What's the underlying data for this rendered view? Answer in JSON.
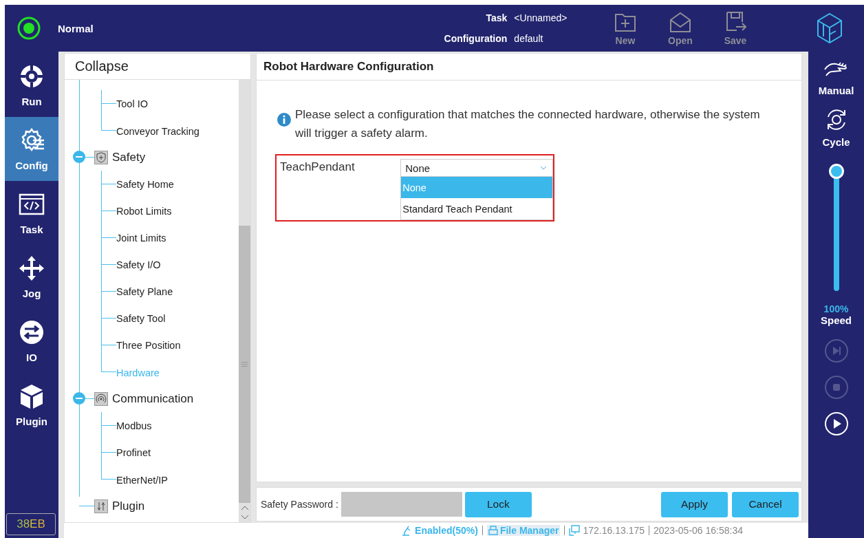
{
  "top_bar": {
    "status": "Normal",
    "task_label": "Task",
    "task_value": "<Unnamed>",
    "config_label": "Configuration",
    "config_value": "default",
    "actions": [
      {
        "kind": "new",
        "label": "New",
        "disabled": true
      },
      {
        "kind": "open",
        "label": "Open",
        "disabled": true
      },
      {
        "kind": "save",
        "label": "Save",
        "disabled": true
      }
    ]
  },
  "nav": [
    {
      "kind": "run",
      "label": "Run",
      "selected": false
    },
    {
      "kind": "config",
      "label": "Config",
      "selected": true
    },
    {
      "kind": "task",
      "label": "Task",
      "selected": false
    },
    {
      "kind": "jog",
      "label": "Jog",
      "selected": false
    },
    {
      "kind": "io",
      "label": "IO",
      "selected": false
    },
    {
      "kind": "plugin",
      "label": "Plugin",
      "selected": false
    }
  ],
  "version_badge": "38EB",
  "tree": {
    "header": "Collapse",
    "nodes": [
      {
        "children": [
          {
            "label": "Tool IO",
            "selected": false
          },
          {
            "label": "Conveyor Tracking",
            "selected": false
          }
        ]
      },
      {
        "kind": "safety",
        "label": "Safety",
        "expanded": true,
        "children": [
          {
            "label": "Safety Home",
            "selected": false
          },
          {
            "label": "Robot Limits",
            "selected": false
          },
          {
            "label": "Joint Limits",
            "selected": false
          },
          {
            "label": "Safety I/O",
            "selected": false
          },
          {
            "label": "Safety Plane",
            "selected": false
          },
          {
            "label": "Safety Tool",
            "selected": false
          },
          {
            "label": "Three Position",
            "selected": false
          },
          {
            "label": "Hardware",
            "selected": true
          }
        ]
      },
      {
        "kind": "communication",
        "label": "Communication",
        "expanded": true,
        "children": [
          {
            "label": "Modbus",
            "selected": false
          },
          {
            "label": "Profinet",
            "selected": false
          },
          {
            "label": "EtherNet/IP",
            "selected": false
          }
        ]
      },
      {
        "kind": "plugin",
        "label": "Plugin",
        "expanded": false
      }
    ]
  },
  "main": {
    "title": "Robot Hardware Configuration",
    "info": "Please select a configuration that matches the connected hardware, otherwise the system will trigger a safety alarm.",
    "field": {
      "label": "TeachPendant",
      "value": "None",
      "expanded": true,
      "options": [
        {
          "label": "None",
          "selected": true
        },
        {
          "label": "Standard Teach Pendant",
          "selected": false
        }
      ]
    }
  },
  "bottom_bar": {
    "password_label": "Safety Password :",
    "lock": "Lock",
    "apply": "Apply",
    "cancel": "Cancel"
  },
  "status_bar": {
    "enabled": "Enabled(50%)",
    "file_manager": "File Manager",
    "ip": "172.16.13.175",
    "datetime": "2023-05-06 16:58:34"
  },
  "right_rail": {
    "mode": "Manual",
    "cycle": "Cycle",
    "speed": {
      "level": 1.0,
      "reading": "100%",
      "label": "Speed"
    },
    "controls": [
      {
        "kind": "step",
        "disabled": true
      },
      {
        "kind": "stop",
        "disabled": true
      },
      {
        "kind": "play",
        "disabled": false
      }
    ]
  }
}
